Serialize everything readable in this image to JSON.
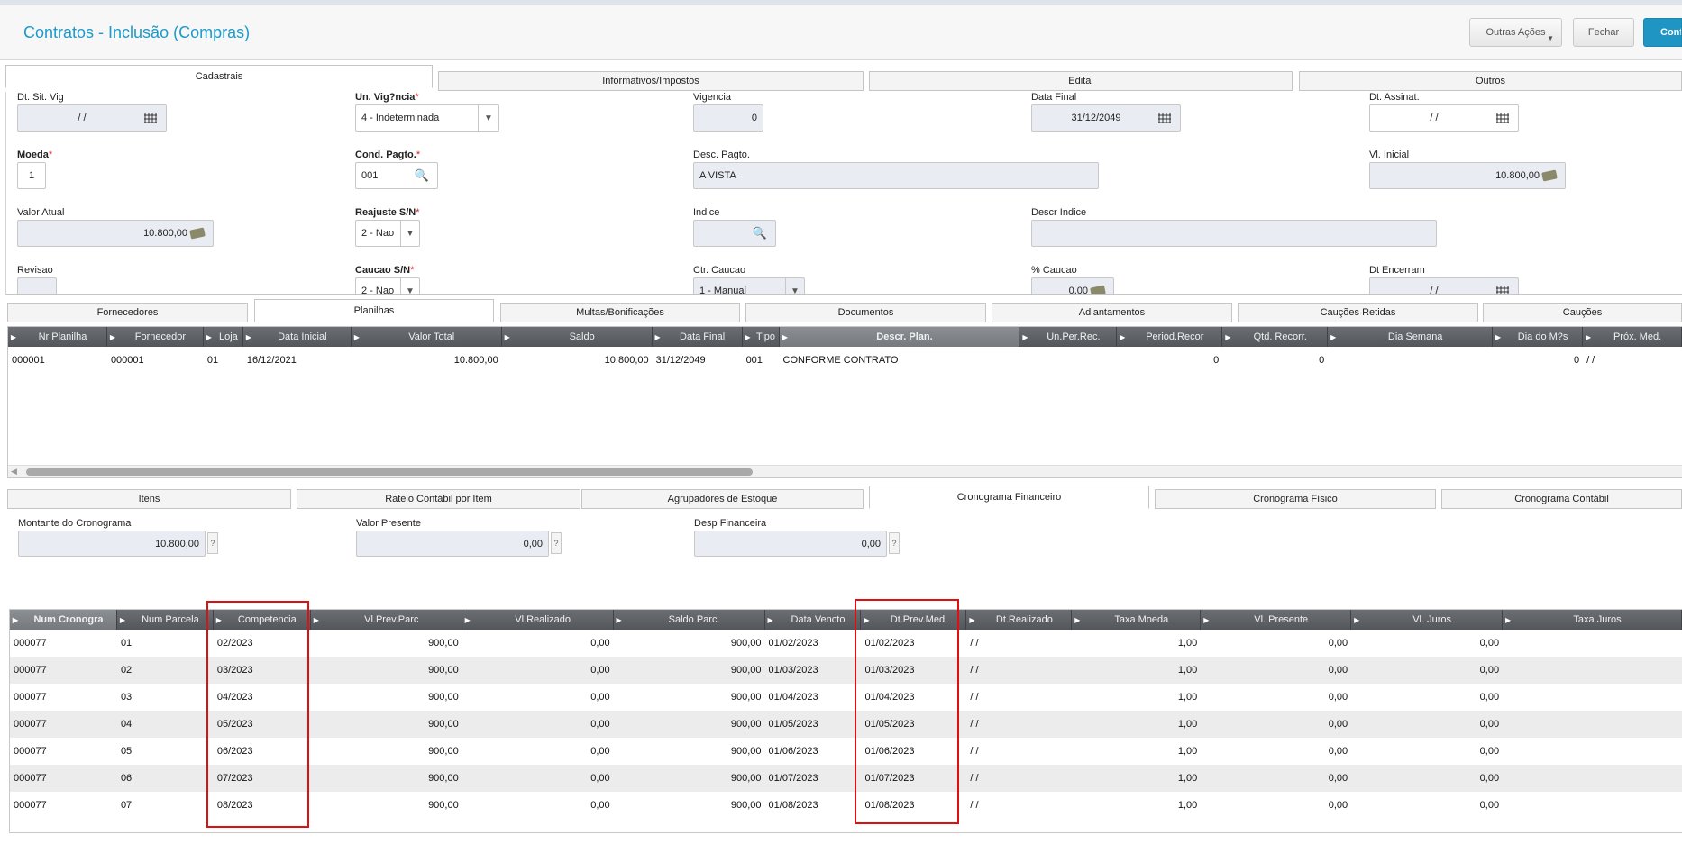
{
  "header": {
    "title": "Contratos - Inclusão (Compras)",
    "buttons": {
      "more_actions": "Outras Ações",
      "close": "Fechar",
      "confirm": "Confi"
    }
  },
  "main_tabs": [
    "Cadastrais",
    "Informativos/Impostos",
    "Edital",
    "Outros"
  ],
  "form": {
    "dt_sit_vig": {
      "label": "Dt. Sit. Vig",
      "value": "/ /"
    },
    "un_vigencia": {
      "label": "Un. Vig?ncia",
      "value": "4 - Indeterminada"
    },
    "vigencia": {
      "label": "Vigencia",
      "value": "0"
    },
    "data_final": {
      "label": "Data Final",
      "value": "31/12/2049"
    },
    "dt_assinat": {
      "label": "Dt. Assinat.",
      "value": "/ /"
    },
    "moeda": {
      "label": "Moeda",
      "value": "1"
    },
    "cond_pagto": {
      "label": "Cond. Pagto.",
      "value": "001"
    },
    "desc_pagto": {
      "label": "Desc. Pagto.",
      "value": "A VISTA"
    },
    "vl_inicial": {
      "label": "Vl. Inicial",
      "value": "10.800,00"
    },
    "valor_atual": {
      "label": "Valor Atual",
      "value": "10.800,00"
    },
    "reajuste": {
      "label": "Reajuste S/N",
      "value": "2 - Nao"
    },
    "indice": {
      "label": "Indice",
      "value": ""
    },
    "descr_indice": {
      "label": "Descr Indice",
      "value": ""
    },
    "revisao": {
      "label": "Revisao",
      "value": ""
    },
    "caucao": {
      "label": "Caucao S/N",
      "value": "2 - Nao"
    },
    "ctr_caucao": {
      "label": "Ctr. Caucao",
      "value": "1 - Manual"
    },
    "perc_caucao": {
      "label": "% Caucao",
      "value": "0,00"
    },
    "dt_encerram": {
      "label": "Dt Encerram",
      "value": "/ /"
    }
  },
  "section_tabs": [
    "Fornecedores",
    "Planilhas",
    "Multas/Bonificações",
    "Documentos",
    "Adiantamentos",
    "Cauções Retidas",
    "Cauções"
  ],
  "planilhas": {
    "columns": [
      "Nr Planilha",
      "Fornecedor",
      "Loja",
      "Data Inicial",
      "Valor Total",
      "Saldo",
      "Data Final",
      "Tipo",
      "Descr. Plan.",
      "Un.Per.Rec.",
      "Period.Recor",
      "Qtd. Recorr.",
      "Dia Semana",
      "Dia do M?s",
      "Próx. Med."
    ],
    "rows": [
      [
        "000001",
        "000001",
        "01",
        "16/12/2021",
        "10.800,00",
        "10.800,00",
        "31/12/2049",
        "001",
        "CONFORME CONTRATO",
        "",
        "0",
        "0",
        "",
        "0",
        "/ /"
      ]
    ]
  },
  "item_tabs": [
    "Itens",
    "Rateio Contábil por Item",
    "Agrupadores de Estoque",
    "Cronograma Financeiro",
    "Cronograma Físico",
    "Cronograma Contábil"
  ],
  "cronograma": {
    "montante": {
      "label": "Montante do Cronograma",
      "value": "10.800,00"
    },
    "valor_presente": {
      "label": "Valor Presente",
      "value": "0,00"
    },
    "desp_financeira": {
      "label": "Desp Financeira",
      "value": "0,00"
    },
    "help": "?",
    "columns": [
      "Num Cronogra",
      "Num Parcela",
      "Competencia",
      "Vl.Prev.Parc",
      "Vl.Realizado",
      "Saldo Parc.",
      "Data Vencto",
      "Dt.Prev.Med.",
      "Dt.Realizado",
      "Taxa Moeda",
      "Vl. Presente",
      "Vl. Juros",
      "Taxa Juros"
    ],
    "rows": [
      [
        "000077",
        "01",
        "02/2023",
        "900,00",
        "0,00",
        "900,00",
        "01/02/2023",
        "01/02/2023",
        "/ /",
        "1,00",
        "0,00",
        "0,00",
        ""
      ],
      [
        "000077",
        "02",
        "03/2023",
        "900,00",
        "0,00",
        "900,00",
        "01/03/2023",
        "01/03/2023",
        "/ /",
        "1,00",
        "0,00",
        "0,00",
        ""
      ],
      [
        "000077",
        "03",
        "04/2023",
        "900,00",
        "0,00",
        "900,00",
        "01/04/2023",
        "01/04/2023",
        "/ /",
        "1,00",
        "0,00",
        "0,00",
        ""
      ],
      [
        "000077",
        "04",
        "05/2023",
        "900,00",
        "0,00",
        "900,00",
        "01/05/2023",
        "01/05/2023",
        "/ /",
        "1,00",
        "0,00",
        "0,00",
        ""
      ],
      [
        "000077",
        "05",
        "06/2023",
        "900,00",
        "0,00",
        "900,00",
        "01/06/2023",
        "01/06/2023",
        "/ /",
        "1,00",
        "0,00",
        "0,00",
        ""
      ],
      [
        "000077",
        "06",
        "07/2023",
        "900,00",
        "0,00",
        "900,00",
        "01/07/2023",
        "01/07/2023",
        "/ /",
        "1,00",
        "0,00",
        "0,00",
        ""
      ],
      [
        "000077",
        "07",
        "08/2023",
        "900,00",
        "0,00",
        "900,00",
        "01/08/2023",
        "01/08/2023",
        "/ /",
        "1,00",
        "0,00",
        "0,00",
        ""
      ]
    ]
  },
  "colors": {
    "accent": "#1e95c3",
    "title": "#1d9ac9",
    "highlight_box": "#e01010",
    "grid_header": "#5f6367"
  }
}
